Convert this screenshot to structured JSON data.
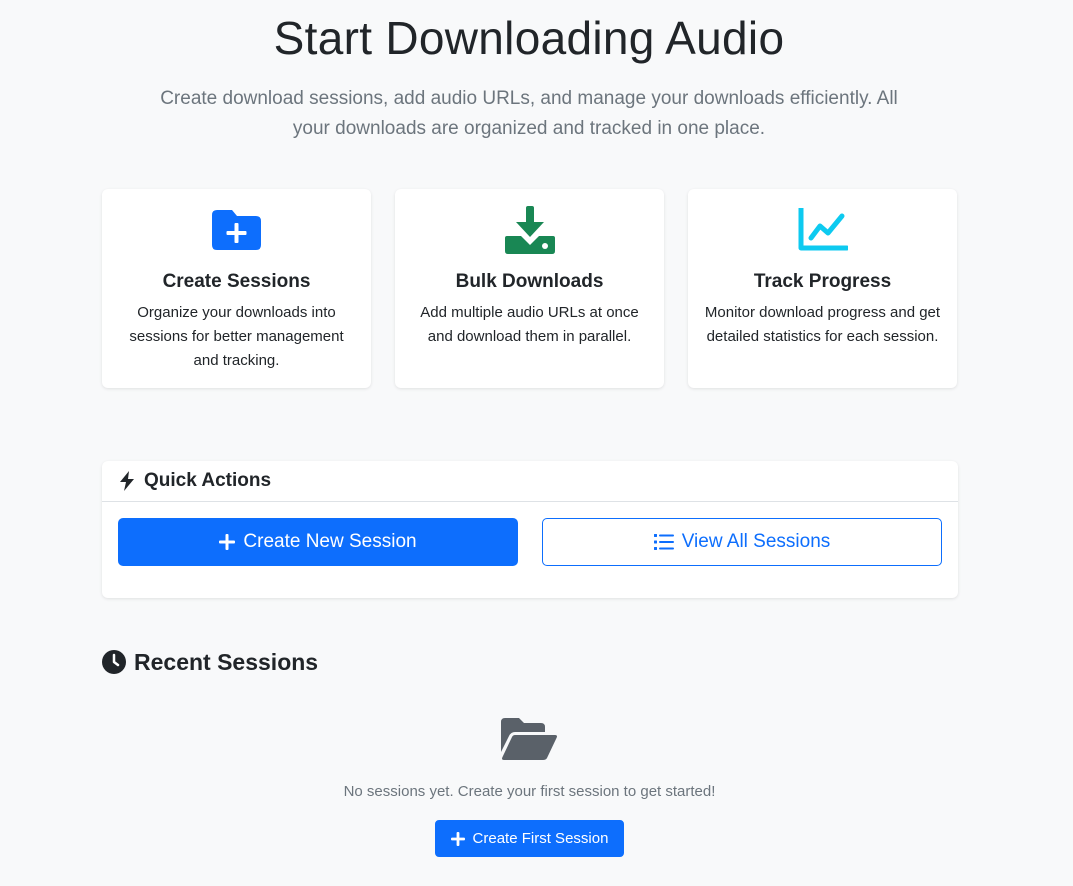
{
  "hero": {
    "title": "Start Downloading Audio",
    "lead": "Create download sessions, add audio URLs, and manage your downloads efficiently. All your downloads are organized and tracked in one place."
  },
  "features": [
    {
      "icon": "folder-plus-icon",
      "color": "#0d6efd",
      "title": "Create Sessions",
      "description": "Organize your downloads into sessions for better management and tracking."
    },
    {
      "icon": "download-icon",
      "color": "#198754",
      "title": "Bulk Downloads",
      "description": "Add multiple audio URLs at once and download them in parallel."
    },
    {
      "icon": "chart-line-icon",
      "color": "#0dcaf0",
      "title": "Track Progress",
      "description": "Monitor download progress and get detailed statistics for each session."
    }
  ],
  "quick_actions": {
    "title": "Quick Actions",
    "icon": "bolt-icon",
    "create_label": "Create New Session",
    "view_label": "View All Sessions"
  },
  "recent": {
    "title": "Recent Sessions",
    "icon": "clock-icon",
    "empty_icon": "folder-open-icon",
    "empty_text": "No sessions yet. Create your first session to get started!",
    "create_first_label": "Create First Session"
  },
  "colors": {
    "primary": "#0d6efd",
    "success": "#198754",
    "info": "#0dcaf0",
    "background": "#f8f9fa",
    "muted": "#6c757d"
  }
}
